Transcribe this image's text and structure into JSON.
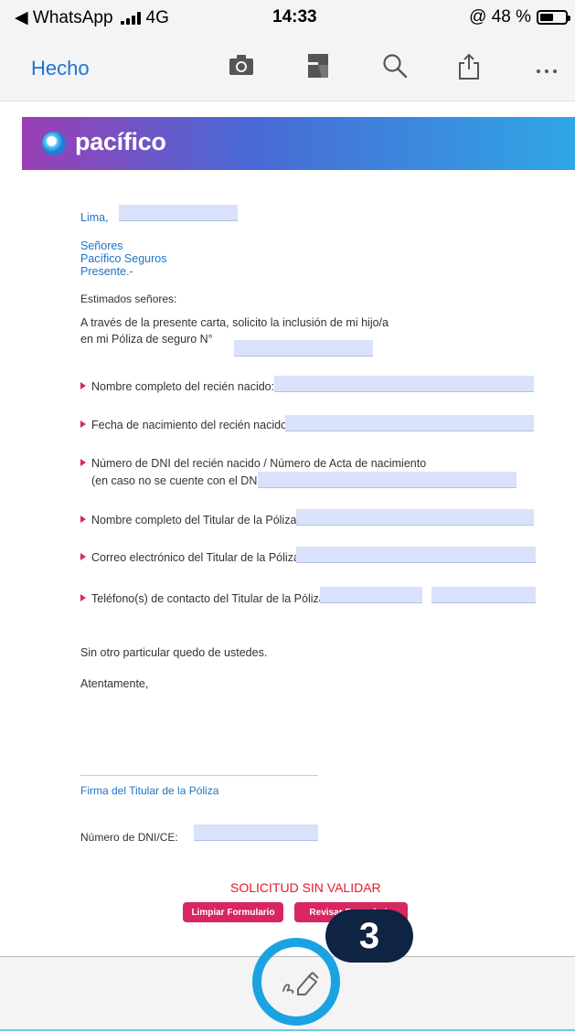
{
  "status_bar": {
    "back_app": "◀ WhatsApp",
    "network": "4G",
    "time": "14:33",
    "battery_text": "@ 48 %",
    "battery_level": 0.48
  },
  "toolbar": {
    "done_label": "Hecho",
    "icons": [
      "camera-icon",
      "document-icon",
      "search-icon",
      "share-icon",
      "more-icon"
    ]
  },
  "banner": {
    "brand": "pacífico"
  },
  "letter": {
    "city": "Lima,",
    "recipient_lines": [
      "Señores",
      "Pacífico Seguros",
      "Presente.-"
    ],
    "greeting": "Estimados señores:",
    "intro_line1": "A través de la presente carta, solicito la inclusión de mi hijo/a",
    "intro_line2": "en mi Póliza de seguro N°",
    "fields": [
      {
        "label": "Nombre completo del recién nacido:"
      },
      {
        "label": "Fecha de nacimiento del recién nacido:"
      },
      {
        "label": "Número de DNI del recién nacido / Número de Acta de nacimiento",
        "label2": "(en caso no se cuente con el DNI):"
      },
      {
        "label": "Nombre completo del Titular de la Póliza:"
      },
      {
        "label": "Correo electrónico del Titular de la Póliza:"
      },
      {
        "label": "Teléfono(s) de contacto del Titular de la Póliza:"
      }
    ],
    "closing": "Sin otro particular quedo de ustedes.",
    "regards": "Atentamente,",
    "signature_label": "Firma del Titular de la Póliza",
    "dni_label": "Número de DNI/CE:",
    "status_text": "SOLICITUD SIN VALIDAR",
    "clear_button": "Limpiar Formulario",
    "review_button": "Revisar Formulario"
  },
  "overlay": {
    "step_number": "3"
  },
  "bottom_bar": {
    "tool_icon": "markup-pen-icon"
  }
}
